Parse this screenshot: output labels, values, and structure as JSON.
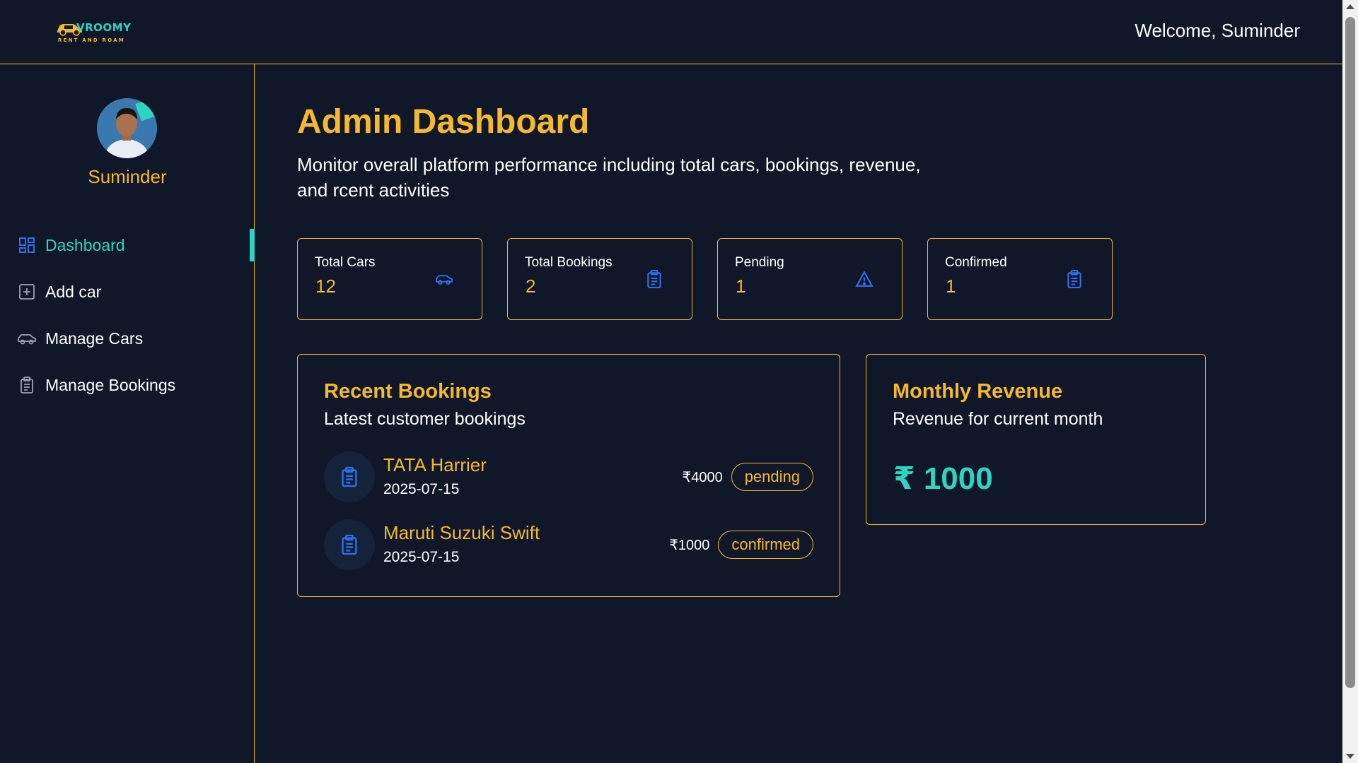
{
  "header": {
    "logo_word": "VROOMY",
    "logo_tag": "RENT AND ROAM",
    "welcome": "Welcome, Suminder"
  },
  "sidebar": {
    "profile_name": "Suminder",
    "items": [
      {
        "label": "Dashboard",
        "icon": "dashboard-icon",
        "active": true
      },
      {
        "label": "Add car",
        "icon": "add-square-icon",
        "active": false
      },
      {
        "label": "Manage Cars",
        "icon": "car-icon",
        "active": false
      },
      {
        "label": "Manage Bookings",
        "icon": "clipboard-icon",
        "active": false
      }
    ]
  },
  "main": {
    "title": "Admin Dashboard",
    "subtitle": "Monitor overall platform performance including total cars, bookings, revenue, and rcent activities",
    "stats": [
      {
        "label": "Total Cars",
        "value": "12",
        "icon": "car-icon"
      },
      {
        "label": "Total Bookings",
        "value": "2",
        "icon": "clipboard-icon"
      },
      {
        "label": "Pending",
        "value": "1",
        "icon": "warning-icon"
      },
      {
        "label": "Confirmed",
        "value": "1",
        "icon": "clipboard-icon"
      }
    ],
    "recent": {
      "title": "Recent Bookings",
      "subtitle": "Latest customer bookings",
      "bookings": [
        {
          "car": "TATA Harrier",
          "date": "2025-07-15",
          "amount": "₹4000",
          "status": "pending"
        },
        {
          "car": "Maruti Suzuki Swift",
          "date": "2025-07-15",
          "amount": "₹1000",
          "status": "confirmed"
        }
      ]
    },
    "revenue": {
      "title": "Monthly Revenue",
      "subtitle": "Revenue for current month",
      "value": "₹ 1000"
    }
  },
  "colors": {
    "background": "#0f1729",
    "accent": "#f5b82e",
    "teal": "#2dd4bf",
    "icon_blue": "#2f6fed"
  }
}
